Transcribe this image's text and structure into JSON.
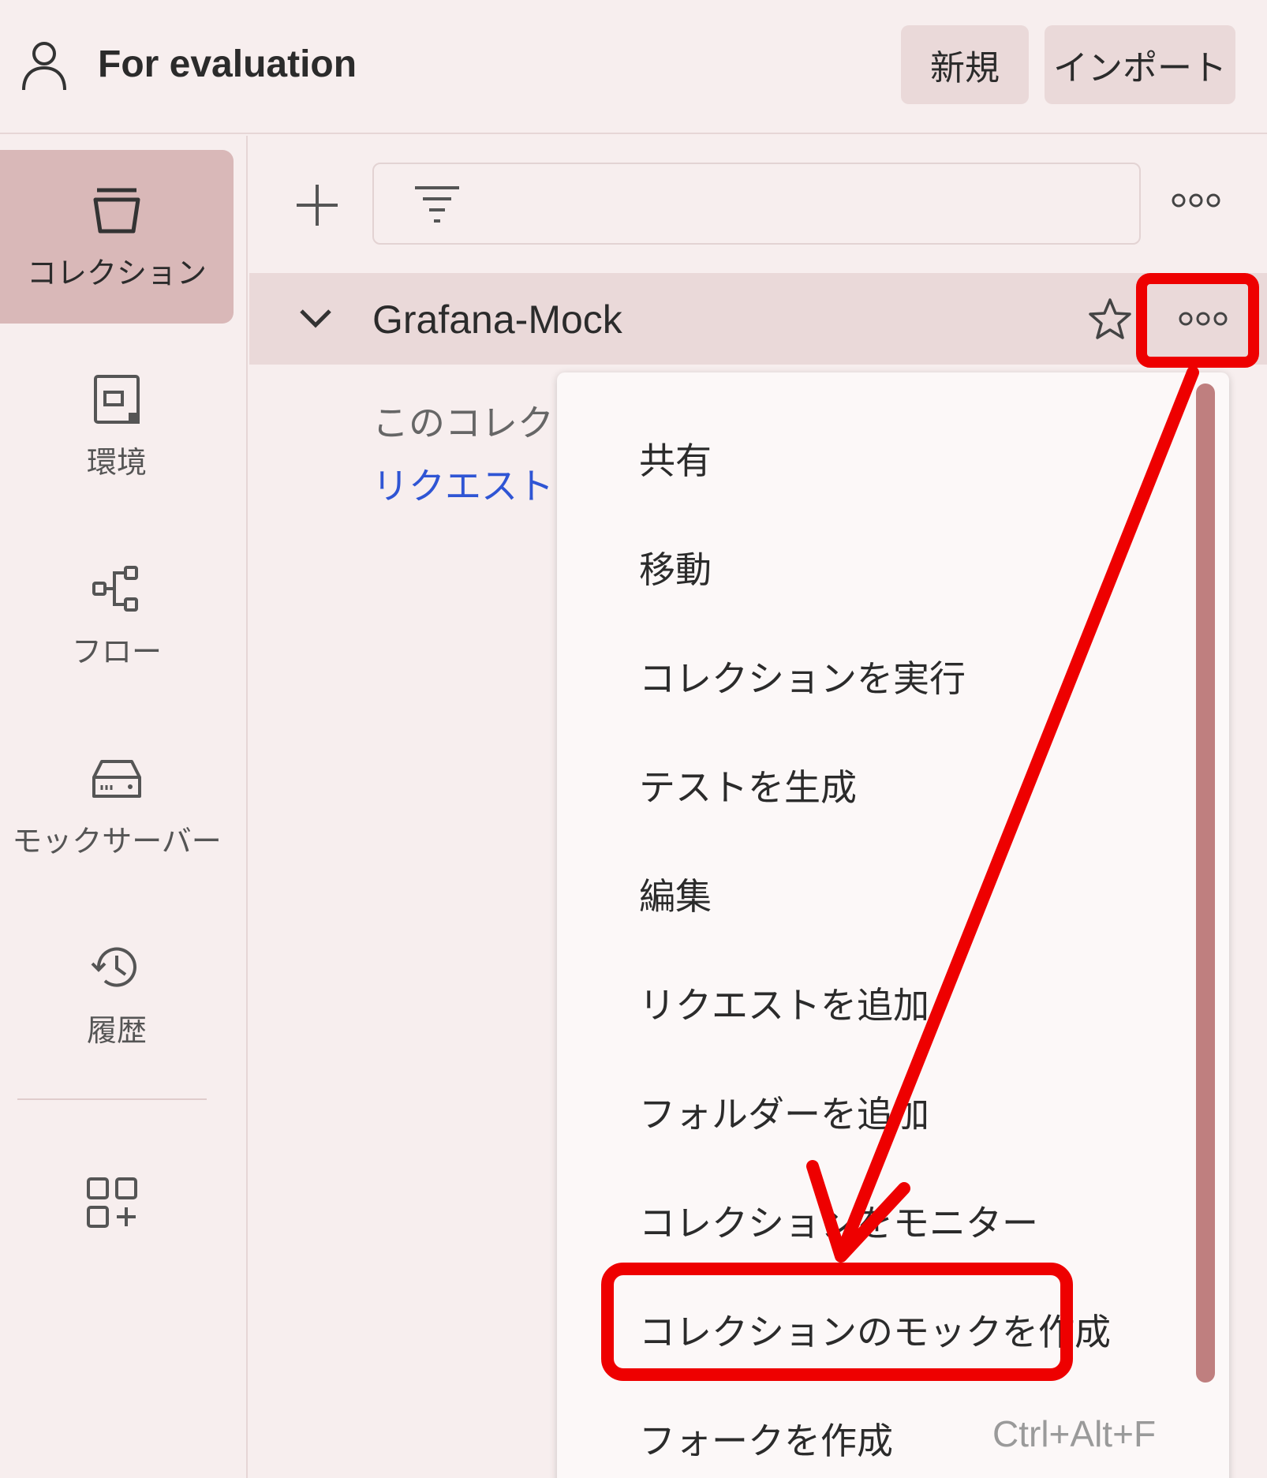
{
  "header": {
    "workspace_title": "For evaluation",
    "new_button": "新規",
    "import_button": "インポート"
  },
  "sidebar": {
    "items": [
      {
        "label": "コレクション",
        "icon": "collection-icon",
        "active": true
      },
      {
        "label": "環境",
        "icon": "environment-icon",
        "active": false
      },
      {
        "label": "フロー",
        "icon": "flow-icon",
        "active": false
      },
      {
        "label": "モックサーバー",
        "icon": "mock-server-icon",
        "active": false
      },
      {
        "label": "履歴",
        "icon": "history-icon",
        "active": false
      }
    ],
    "apps_icon": "apps-add-icon"
  },
  "toolbar": {
    "search_value": ""
  },
  "collection": {
    "name": "Grafana-Mock",
    "empty_text": "このコレクシ",
    "empty_link": "リクエストを"
  },
  "menu": {
    "items": [
      {
        "label": "共有"
      },
      {
        "label": "移動"
      },
      {
        "label": "コレクションを実行"
      },
      {
        "label": "テストを生成"
      },
      {
        "label": "編集"
      },
      {
        "label": "リクエストを追加"
      },
      {
        "label": "フォルダーを追加"
      },
      {
        "label": "コレクションをモニター"
      },
      {
        "label": "コレクションのモックを作成",
        "highlighted": true
      },
      {
        "label": "フォークを作成",
        "shortcut": "Ctrl+Alt+F"
      }
    ]
  },
  "colors": {
    "accent": "#ee0000",
    "active_nav": "#d9b8b8",
    "link": "#2f55d4"
  }
}
